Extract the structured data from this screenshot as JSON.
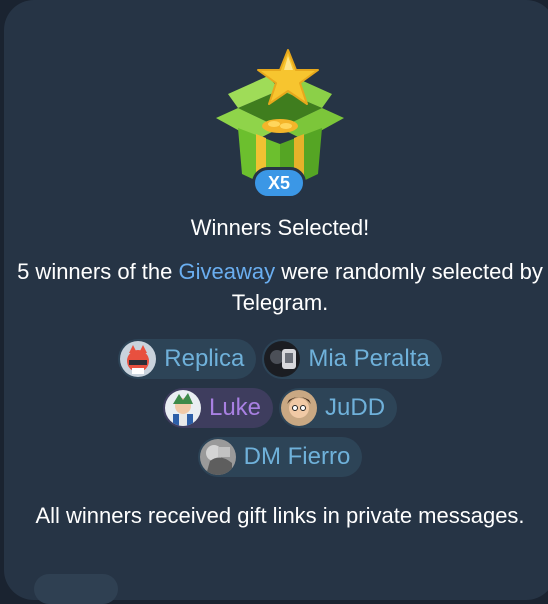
{
  "hero": {
    "icon": "gift-box-star-icon",
    "multiplier": "X5"
  },
  "title": "Winners Selected!",
  "description": {
    "before": "5 winners of the ",
    "link": "Giveaway",
    "after": " were randomly selected by Telegram."
  },
  "winners": [
    {
      "name": "Replica",
      "avatar": "red-cat-avatar",
      "color": "#6fb1da"
    },
    {
      "name": "Mia Peralta",
      "avatar": "dark-photo-avatar",
      "color": "#6fb1da"
    },
    {
      "name": "Luke",
      "avatar": "character-avatar",
      "color": "#a880e2"
    },
    {
      "name": "JuDD",
      "avatar": "portrait-avatar",
      "color": "#6fb1da"
    },
    {
      "name": "DM Fierro",
      "avatar": "grayscale-photo-avatar",
      "color": "#6fb1da"
    }
  ],
  "footer": "All winners received gift links in private messages.",
  "colors": {
    "background": "#263445",
    "accent": "#6aaef0",
    "badge": "#3b97e6",
    "chip": "#2d4457",
    "chip_purple": "#3e3d5e"
  }
}
